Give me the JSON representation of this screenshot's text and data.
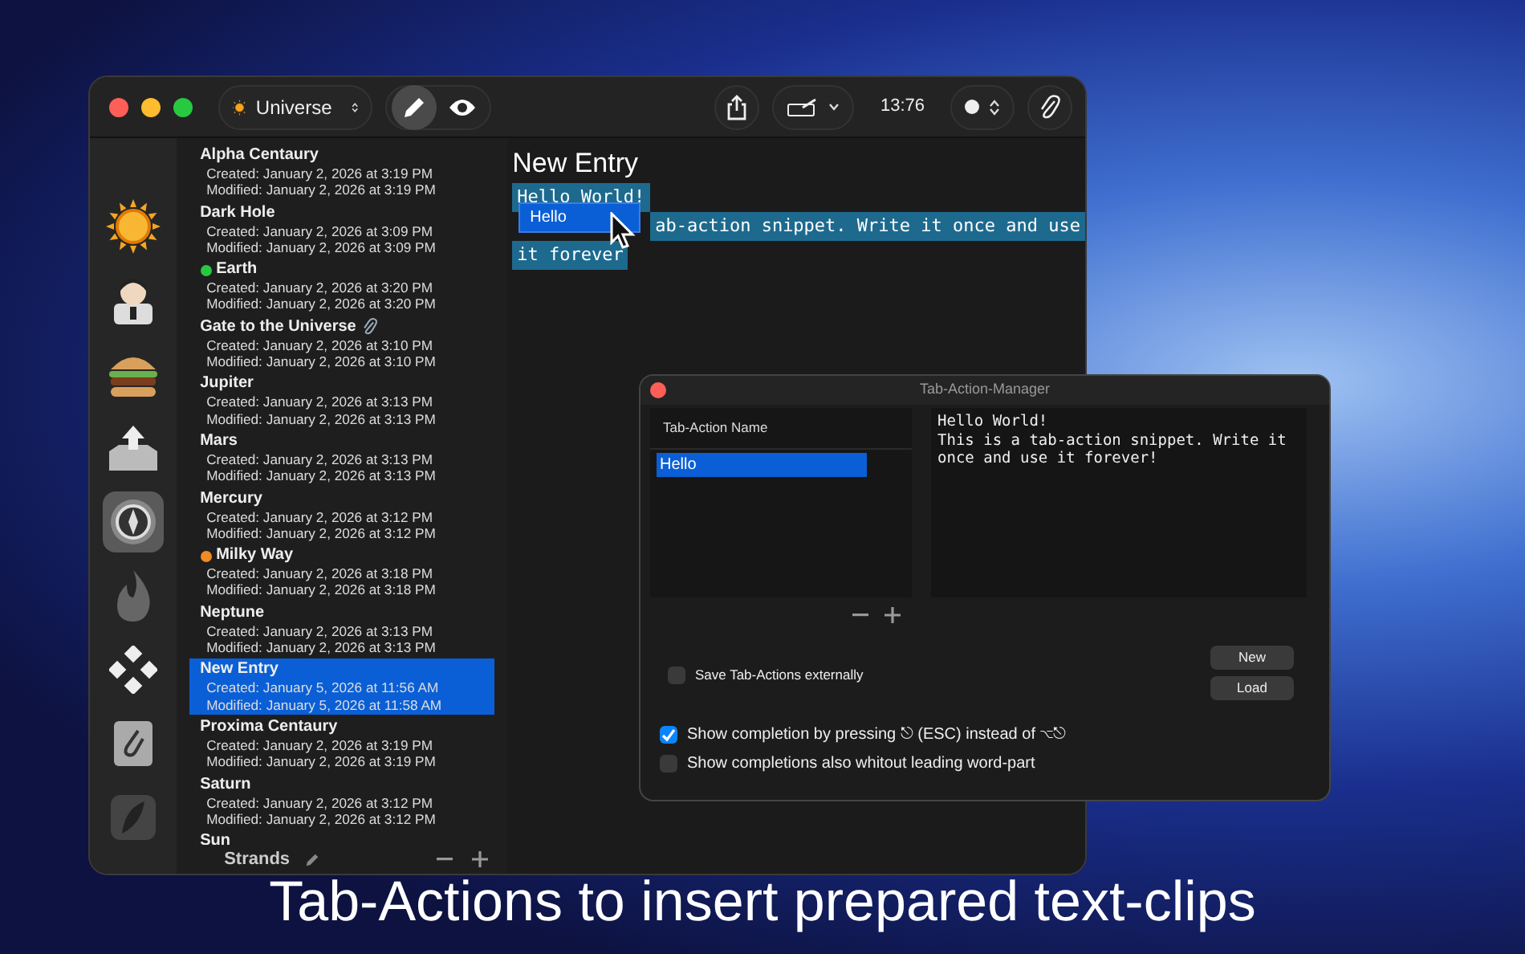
{
  "main_window": {
    "toolbar": {
      "collection": "Universe",
      "mode_buttons": [
        {
          "kind": "edit",
          "selected": true
        },
        {
          "kind": "preview",
          "selected": false
        }
      ],
      "time": "13:76"
    },
    "icon_sidebar": {
      "items": [
        {
          "kind": "sun",
          "selected": false
        },
        {
          "kind": "person",
          "selected": false
        },
        {
          "kind": "burger",
          "selected": false
        },
        {
          "kind": "tray",
          "selected": false
        },
        {
          "kind": "compass",
          "selected": true
        },
        {
          "kind": "flame",
          "selected": false
        },
        {
          "kind": "diamonds",
          "selected": false
        },
        {
          "kind": "clip",
          "selected": false
        },
        {
          "kind": "feather",
          "selected": false
        }
      ]
    },
    "entries": [
      {
        "title": "Alpha Centaury",
        "created": "Created: January 2, 2026 at 3:19 PM",
        "modified": "Modified: January 2, 2026 at 3:19 PM",
        "attachment": false,
        "selected": false
      },
      {
        "title": "Dark Hole",
        "created": "Created: January 2, 2026 at 3:09 PM",
        "modified": "Modified: January 2, 2026 at 3:09 PM",
        "attachment": false,
        "selected": false
      },
      {
        "title": "Earth",
        "created": "Created: January 2, 2026 at 3:20 PM",
        "modified": "Modified: January 2, 2026 at 3:20 PM",
        "color": "#28c840",
        "attachment": false,
        "selected": false
      },
      {
        "title": "Gate to the Universe",
        "created": "Created: January 2, 2026 at 3:10 PM",
        "modified": "Modified: January 2, 2026 at 3:10 PM",
        "attachment": true,
        "selected": false
      },
      {
        "title": "Jupiter",
        "created": "Created: January 2, 2026 at 3:13 PM",
        "modified": "Modified: January 2, 2026 at 3:13 PM",
        "attachment": false,
        "selected": false
      },
      {
        "title": "Mars",
        "created": "Created: January 2, 2026 at 3:13 PM",
        "modified": "Modified: January 2, 2026 at 3:13 PM",
        "attachment": false,
        "selected": false
      },
      {
        "title": "Mercury",
        "created": "Created: January 2, 2026 at 3:12 PM",
        "modified": "Modified: January 2, 2026 at 3:12 PM",
        "attachment": false,
        "selected": false
      },
      {
        "title": "Milky Way",
        "created": "Created: January 2, 2026 at 3:18 PM",
        "modified": "Modified: January 2, 2026 at 3:18 PM",
        "color": "#f08a24",
        "attachment": false,
        "selected": false
      },
      {
        "title": "Neptune",
        "created": "Created: January 2, 2026 at 3:13 PM",
        "modified": "Modified: January 2, 2026 at 3:13 PM",
        "attachment": false,
        "selected": false
      },
      {
        "title": "New Entry",
        "created": "Created: January 5, 2026 at 11:56 AM",
        "modified": "Modified: January 5, 2026 at 11:58 AM",
        "attachment": false,
        "selected": true
      },
      {
        "title": "Proxima Centaury",
        "created": "Created: January 2, 2026 at 3:19 PM",
        "modified": "Modified: January 2, 2026 at 3:19 PM",
        "attachment": false,
        "selected": false
      },
      {
        "title": "Saturn",
        "created": "Created: January 2, 2026 at 3:12 PM",
        "modified": "Modified: January 2, 2026 at 3:12 PM",
        "attachment": false,
        "selected": false
      },
      {
        "title": "Sun",
        "attachment": false,
        "selected": false
      }
    ],
    "list_footer": {
      "label": "Strands"
    },
    "editor": {
      "title": "New Entry",
      "lines": [
        {
          "text": "Hello World!",
          "selected": true
        },
        {
          "text": "ab-action snippet. Write it once and use",
          "selected": true
        },
        {
          "text": "it forever",
          "selected": true
        }
      ],
      "completion_popup": {
        "items": [
          {
            "label": "Hello",
            "selected": true
          }
        ]
      }
    }
  },
  "tab_action_manager": {
    "title": "Tab-Action-Manager",
    "column": "Tab-Action Name",
    "rows": [
      {
        "name": "Hello",
        "selected": true
      }
    ],
    "snippet": "Hello World!\nThis is a tab-action snippet. Write it once and use it forever!",
    "save_externally": {
      "label": "Save Tab-Actions externally",
      "checked": false
    },
    "buttons": [
      "New",
      "Load"
    ],
    "options": [
      {
        "label": "Show completion by pressing ⎋ (ESC) instead of ⌥⎋",
        "checked": true
      },
      {
        "label": "Show completions also whitout leading word-part",
        "checked": false
      }
    ]
  },
  "caption": "Tab-Actions to insert prepared text-clips"
}
